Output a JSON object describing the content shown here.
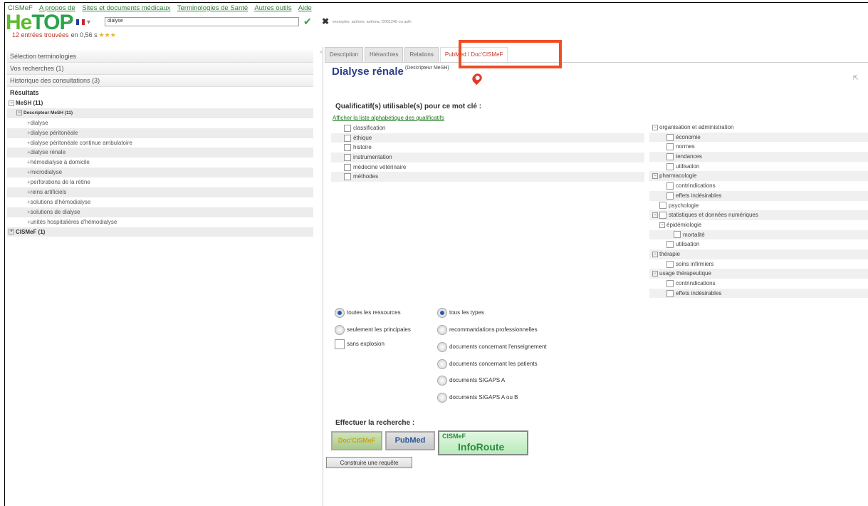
{
  "menu": {
    "brand": "CISMeF",
    "items": [
      "A propos de",
      "Sites et documents médicaux",
      "Terminologies de Santé",
      "Autres outils",
      "Aide"
    ]
  },
  "logo": {
    "he": "He",
    "top": "TOP"
  },
  "search": {
    "value": "dialyse",
    "hint": "exemples: asthme, asthma, D001249 ou asth"
  },
  "results": {
    "count": "12 entrées trouvées",
    "time": "en 0,56 s",
    "stars": "★★★"
  },
  "left": {
    "accordion": [
      "Sélection terminologies",
      "Vos recherches (1)",
      "Historique des consultations (3)"
    ],
    "results_label": "Résultats",
    "tree": [
      {
        "label": "MeSH (11)",
        "level": 0,
        "sign": "−"
      },
      {
        "label": "Descripteur MeSH (11)",
        "level": 1,
        "sign": "−"
      },
      {
        "label": "dialyse",
        "level": 2
      },
      {
        "label": "dialyse péritonéale",
        "level": 2
      },
      {
        "label": "dialyse péritonéale continue ambulatoire",
        "level": 2
      },
      {
        "label": "dialyse rénale",
        "level": 2
      },
      {
        "label": "hémodialyse à domicile",
        "level": 2
      },
      {
        "label": "microdialyse",
        "level": 2
      },
      {
        "label": "perforations de la rétine",
        "level": 2
      },
      {
        "label": "reins artificiels",
        "level": 2
      },
      {
        "label": "solutions d'hémodialyse",
        "level": 2
      },
      {
        "label": "solutions de dialyse",
        "level": 2
      },
      {
        "label": "unités hospitalières d'hémodialyse",
        "level": 2
      },
      {
        "label": "CISMeF (1)",
        "level": 0,
        "sign": "+"
      }
    ]
  },
  "tabs": [
    "Description",
    "Hiérarchies",
    "Relations",
    "PubMed / Doc'CISMeF"
  ],
  "title": {
    "main": "Dialyse rénale",
    "sub": "(Descripteur MeSH)"
  },
  "qualifiers": {
    "heading": "Qualificatif(s) utilisable(s) pour ce mot clé :",
    "link": "Afficher la liste alphabétique des qualificatifs",
    "left": [
      "classification",
      "éthique",
      "histoire",
      "instrumentation",
      "médecine vétérinaire",
      "méthodes"
    ],
    "right": [
      {
        "label": "organisation et administration",
        "indent": 0,
        "type": "group"
      },
      {
        "label": "économie",
        "indent": 2,
        "type": "cb"
      },
      {
        "label": "normes",
        "indent": 2,
        "type": "cb"
      },
      {
        "label": "tendances",
        "indent": 2,
        "type": "cb"
      },
      {
        "label": "utilisation",
        "indent": 2,
        "type": "cb"
      },
      {
        "label": "pharmacologie",
        "indent": 0,
        "type": "group"
      },
      {
        "label": "contrindications",
        "indent": 2,
        "type": "cb"
      },
      {
        "label": "effets indésirables",
        "indent": 2,
        "type": "cb"
      },
      {
        "label": "psychologie",
        "indent": 1,
        "type": "cb"
      },
      {
        "label": "statistiques et données numériques",
        "indent": 0,
        "type": "groupcb"
      },
      {
        "label": "épidémiologie",
        "indent": 1,
        "type": "group"
      },
      {
        "label": "mortalité",
        "indent": 3,
        "type": "cb"
      },
      {
        "label": "utilisation",
        "indent": 2,
        "type": "cb"
      },
      {
        "label": "thérapie",
        "indent": 0,
        "type": "group"
      },
      {
        "label": "soins infirmiers",
        "indent": 2,
        "type": "cb"
      },
      {
        "label": "usage thérapeutique",
        "indent": 0,
        "type": "group"
      },
      {
        "label": "contrindications",
        "indent": 2,
        "type": "cb"
      },
      {
        "label": "effets indésirables",
        "indent": 2,
        "type": "cb"
      }
    ]
  },
  "options": {
    "resources": [
      "toutes les ressources",
      "seulement les principales"
    ],
    "no_explosion": "sans explosion",
    "types": [
      "tous les types",
      "recommandations professionnelles",
      "documents concernant l'enseignement",
      "documents concernant les patients",
      "documents SIGAPS A",
      "documents SIGAPS A ou B"
    ]
  },
  "search_section": {
    "label": "Effectuer la recherche :",
    "doc": "Doc'CISMeF",
    "pubmed": "PubMed",
    "info1": "CISMeF",
    "info2": "InfoRoute",
    "build": "Construire une requête"
  },
  "colors": {
    "accent": "#f04e23",
    "green": "#2aa34a",
    "title": "#2c3e8c"
  }
}
